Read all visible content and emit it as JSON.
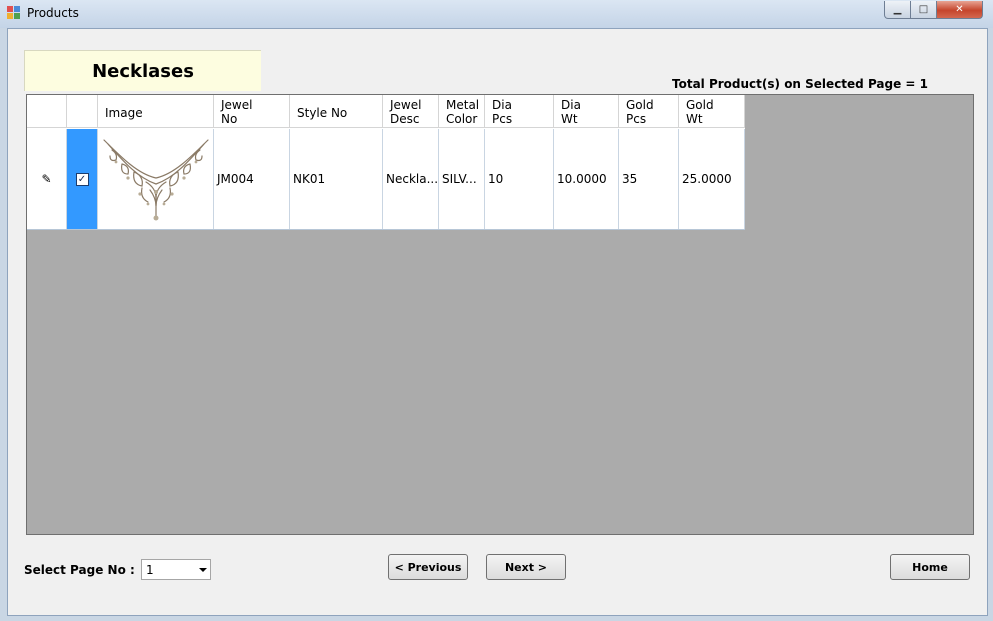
{
  "window": {
    "title": "Products",
    "controls": {
      "minimize": "▁",
      "maximize": "□",
      "close": "✕"
    }
  },
  "header": {
    "category_title": "Necklases",
    "total_label": "Total Product(s) on Selected Page = 1"
  },
  "table": {
    "columns": [
      "Image",
      "Jewel\nNo",
      "Style No",
      "Jewel\nDesc",
      "Metal\nColor",
      "Dia\nPcs",
      "Dia\nWt",
      "Gold\nPcs",
      "Gold\nWt"
    ],
    "column_labels": {
      "image": "Image",
      "jewel_no": [
        "Jewel",
        "No"
      ],
      "style_no": "Style No",
      "jewel_desc": [
        "Jewel",
        "Desc"
      ],
      "metal_color": [
        "Metal",
        "Color"
      ],
      "dia_pcs": [
        "Dia",
        "Pcs"
      ],
      "dia_wt": [
        "Dia",
        "Wt"
      ],
      "gold_pcs": [
        "Gold",
        "Pcs"
      ],
      "gold_wt": [
        "Gold",
        "Wt"
      ]
    },
    "rows": [
      {
        "row_indicator": "✎",
        "selected": true,
        "check_mark": "✓",
        "image": "necklace-image",
        "jewel_no": "JM004",
        "style_no": "NK01",
        "jewel_desc": "Neckla...",
        "metal_color": "SILV...",
        "dia_pcs": "10",
        "dia_wt": "10.0000",
        "gold_pcs": "35",
        "gold_wt": "25.0000"
      }
    ]
  },
  "footer": {
    "page_label": "Select Page No :",
    "page_value": "1",
    "prev_label": "< Previous",
    "next_label": "Next >",
    "home_label": "Home"
  },
  "colors": {
    "selection": "#3399ff",
    "grid_background": "#ababab",
    "category_background": "#fdfde0",
    "form_background": "#f0f0f0"
  }
}
